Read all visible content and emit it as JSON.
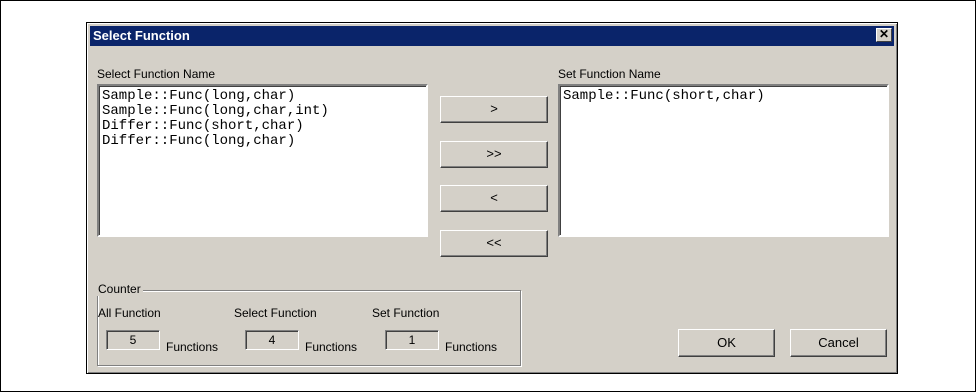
{
  "dialog": {
    "title": "Select Function",
    "close_glyph": "✕"
  },
  "left_list": {
    "label": "Select Function Name",
    "items": [
      "Sample::Func(long,char)",
      "Sample::Func(long,char,int)",
      "Differ::Func(short,char)",
      "Differ::Func(long,char)"
    ]
  },
  "right_list": {
    "label": "Set Function Name",
    "items": [
      "Sample::Func(short,char)"
    ]
  },
  "transfer_buttons": {
    "add": ">",
    "add_all": ">>",
    "remove": "<",
    "remove_all": "<<"
  },
  "counter": {
    "legend": "Counter",
    "all_label": "All Function",
    "all_value": "5",
    "select_label": "Select Function",
    "select_value": "4",
    "set_label": "Set Function",
    "set_value": "1",
    "unit": "Functions"
  },
  "footer": {
    "ok": "OK",
    "cancel": "Cancel"
  }
}
